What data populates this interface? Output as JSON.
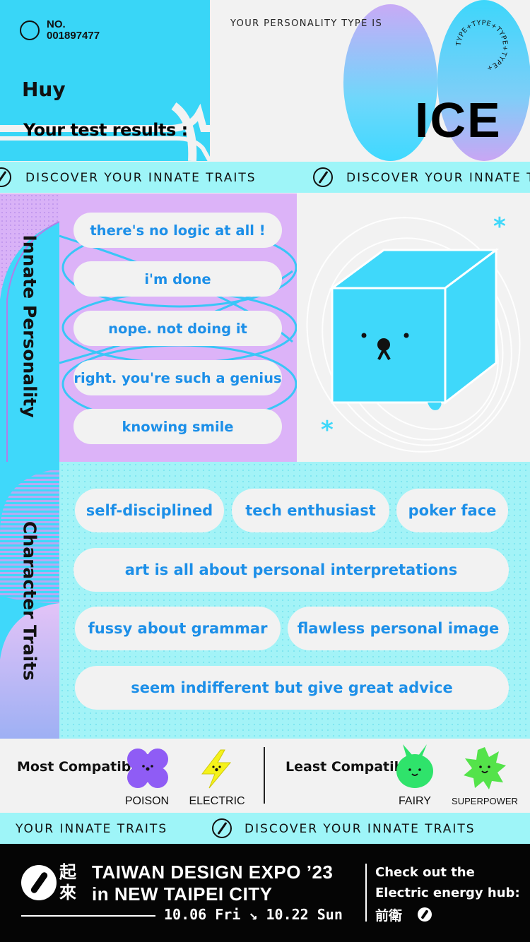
{
  "header": {
    "number_prefix": "NO.",
    "number": "001897477",
    "user_name": "Huy",
    "results_heading": "Your test results :",
    "type_label": "YOUR PERSONALITY TYPE IS",
    "type_word": "ICE",
    "type_ring_text": "TYPE+TYPE+TYPE+TYPE+"
  },
  "marquee_top": {
    "items": [
      "DISCOVER YOUR INNATE TRAITS",
      "DISCOVER YOUR INNATE TRAITS"
    ]
  },
  "innate": {
    "title": "Innate Personality",
    "items": [
      "there's no logic at all !",
      "i'm done",
      "nope. not doing it",
      "right. you're such a genius",
      "knowing smile"
    ]
  },
  "character": {
    "title": "Character Traits",
    "items": [
      "self-disciplined",
      "tech enthusiast",
      "poker face",
      "art is all about personal interpretations",
      "fussy about grammar",
      "flawless personal image",
      "seem indifferent but give great advice"
    ]
  },
  "compatibility": {
    "most_title": "Most Compatible",
    "most": [
      {
        "label": "POISON",
        "icon": "poison-creature-icon",
        "color": "#8f5cf5"
      },
      {
        "label": "ELECTRIC",
        "icon": "electric-bolt-icon",
        "color": "#f5f21a"
      }
    ],
    "least_title": "Least Compatible",
    "least": [
      {
        "label": "FAIRY",
        "icon": "fairy-creature-icon",
        "color": "#2fe36b"
      },
      {
        "label": "SUPERPOWER",
        "icon": "superpower-burst-icon",
        "color": "#54e34a"
      }
    ]
  },
  "marquee_bottom": {
    "items": [
      "YOUR INNATE TRAITS",
      "DISCOVER YOUR INNATE TRAITS"
    ]
  },
  "footer": {
    "cjk_logo": "起來",
    "expo_line1": "TAIWAN DESIGN EXPO ’23",
    "expo_line2": "in NEW TAIPEI CITY",
    "dates": "10.06 Fri ↘ 10.22 Sun",
    "checkout_line1": "Check out the",
    "checkout_line2": "Electric energy hub:",
    "brand": "前衛"
  },
  "colors": {
    "cyan": "#39d6f7",
    "light_cyan": "#9ef5f8",
    "lavender": "#dcb3f8",
    "pill_text": "#1c8fe8",
    "footer_bg": "#050505"
  }
}
